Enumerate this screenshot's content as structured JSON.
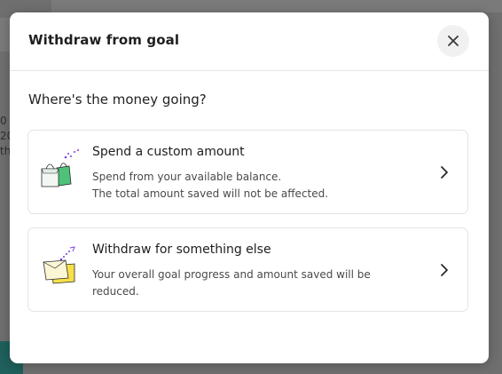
{
  "modal": {
    "title": "Withdraw from goal",
    "close_icon": "close-icon",
    "question": "Where's the money going?"
  },
  "options": [
    {
      "title": "Spend a custom amount",
      "description_line1": "Spend from your available balance.",
      "description_line2": "The total amount saved will not be affected.",
      "icon": "shopping-bags-illustration"
    },
    {
      "title": "Withdraw for something else",
      "description_line1": "Your overall goal progress and amount saved will be",
      "description_line2": "reduced.",
      "icon": "wallet-illustration"
    }
  ],
  "colors": {
    "overlay": "#6f6f6f",
    "modal_bg": "#ffffff",
    "green_accent": "#4fc27a",
    "yellow_accent": "#f7e04a",
    "purple_accent": "#7b3fe4",
    "background_teal": "#1f5f5c"
  }
}
